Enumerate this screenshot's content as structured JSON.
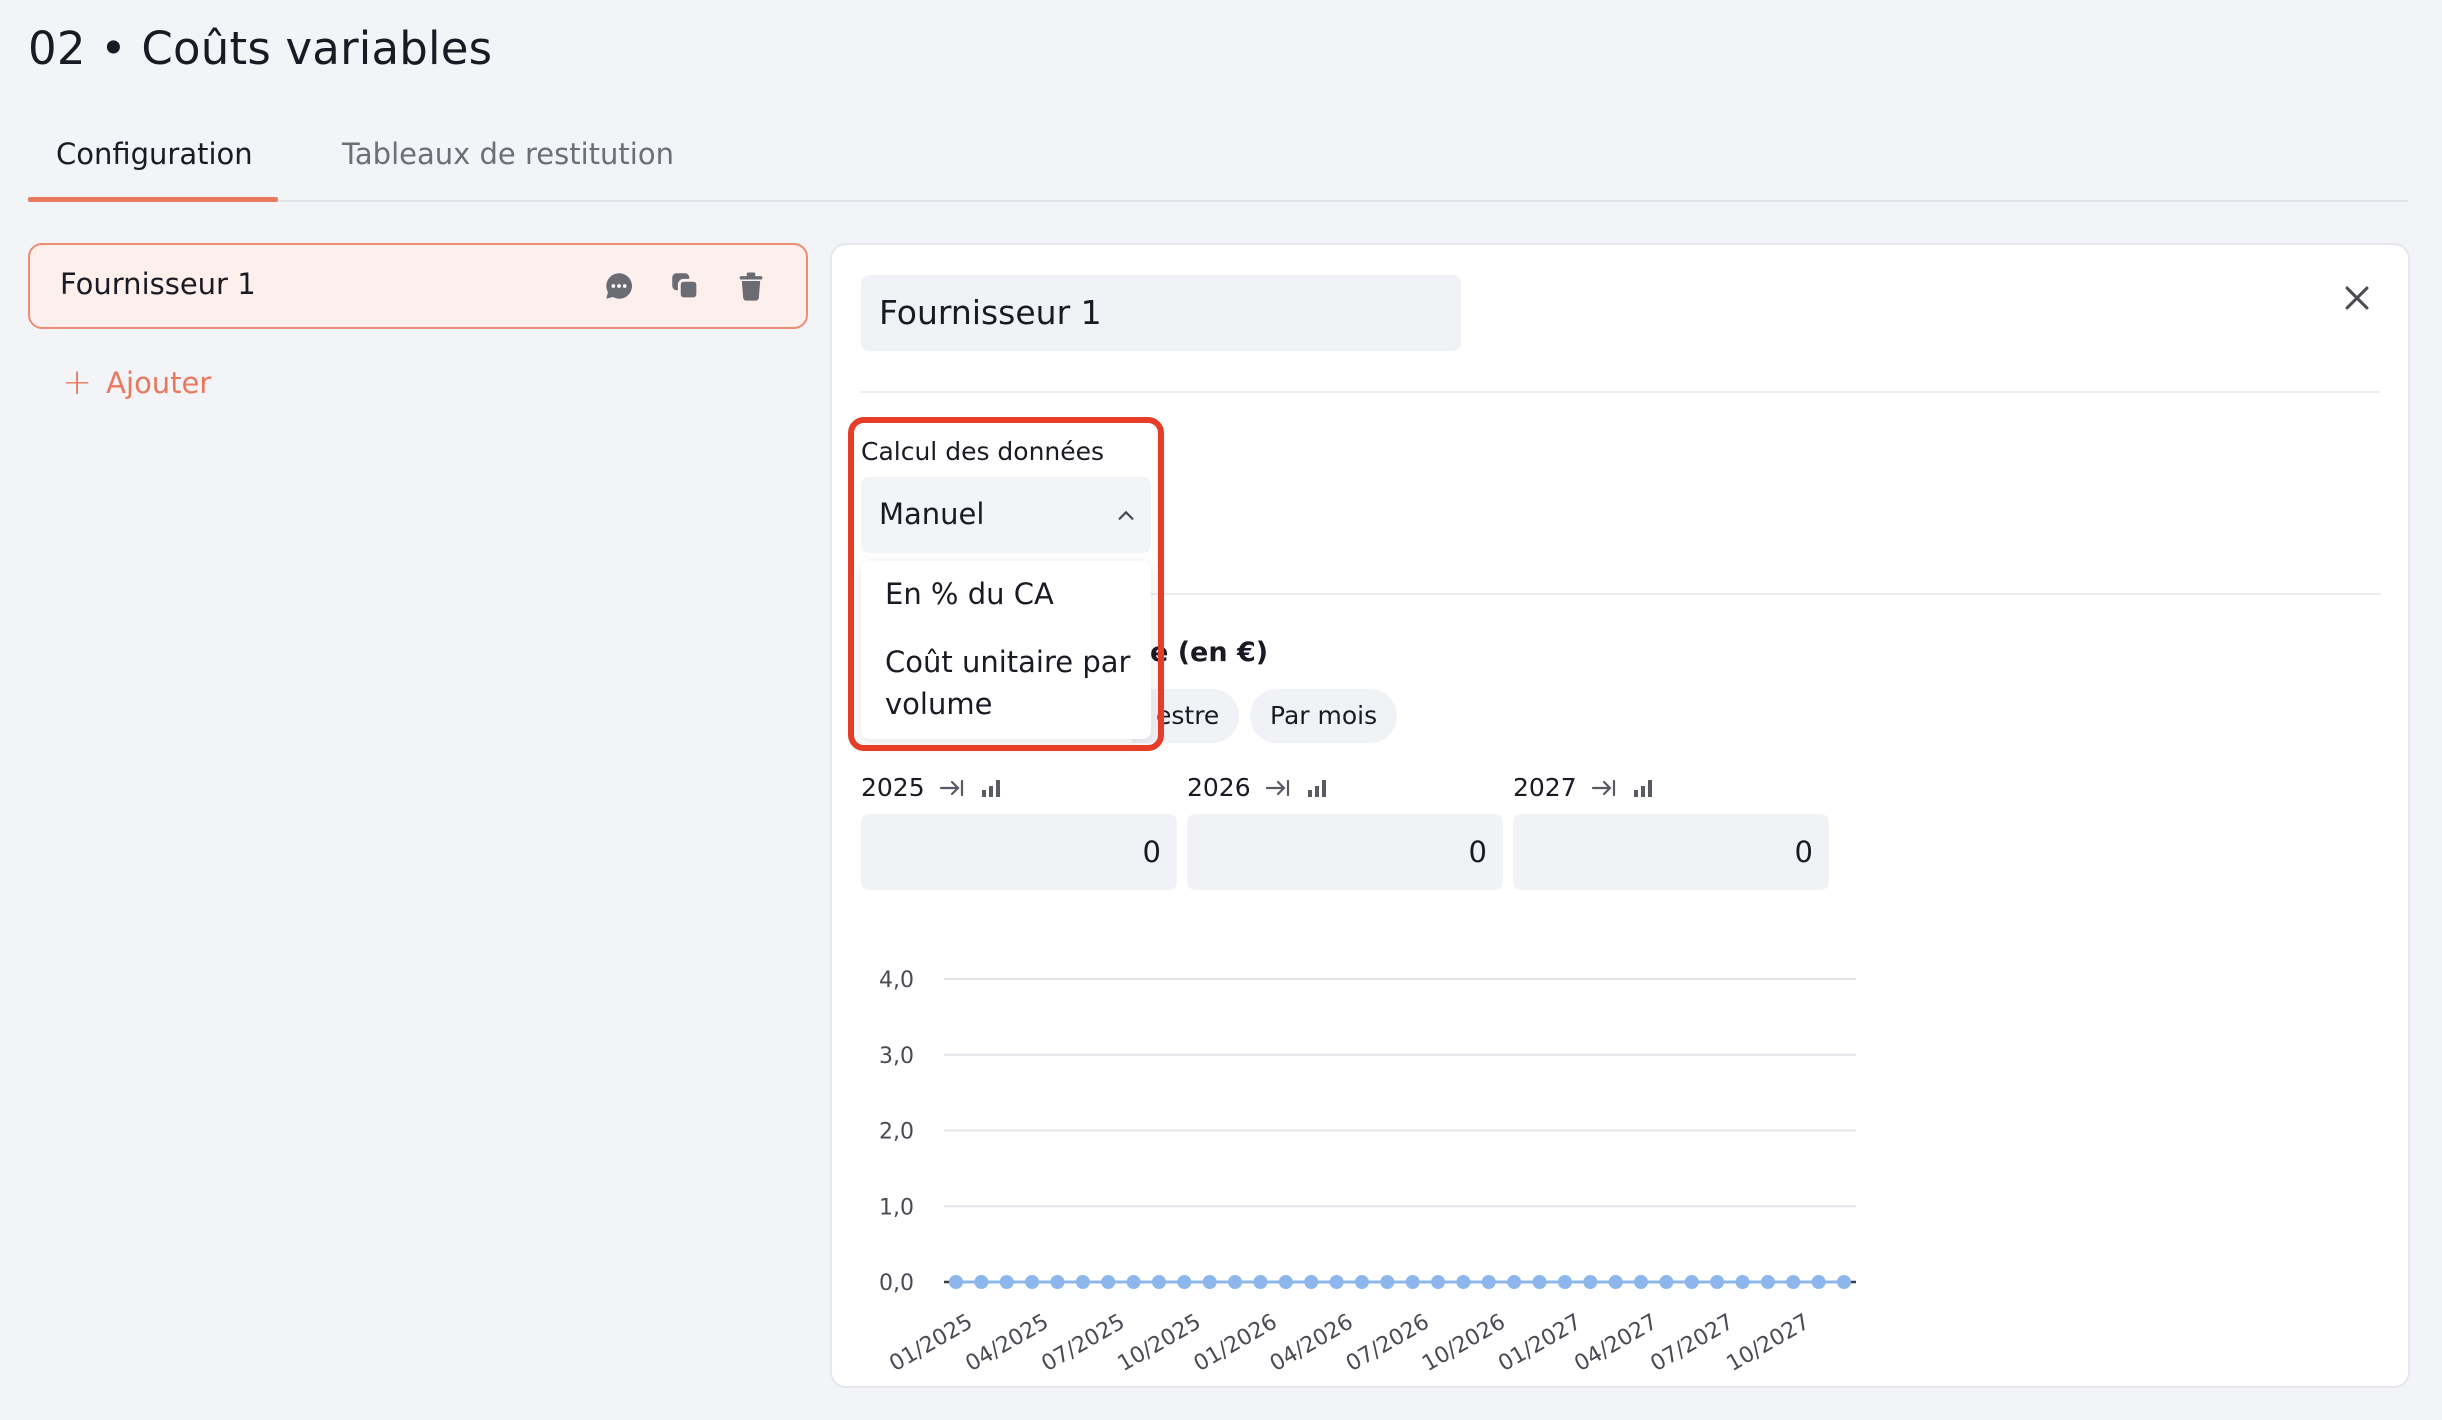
{
  "page": {
    "title": "02 • Coûts variables"
  },
  "tabs": [
    {
      "label": "Configuration",
      "active": true
    },
    {
      "label": "Tableaux de restitution",
      "active": false
    }
  ],
  "sidebar": {
    "items": [
      {
        "label": "Fournisseur 1",
        "icons": [
          "comment-icon",
          "duplicate-icon",
          "trash-icon"
        ]
      }
    ],
    "add_label": "Ajouter"
  },
  "panel": {
    "name_value": "Fournisseur 1",
    "calc": {
      "label": "Calcul des données",
      "selected": "Manuel",
      "options": [
        "En % du CA",
        "Coût unitaire par volume"
      ]
    },
    "section_title_fragment": "e (en €)",
    "period_chips": [
      "estre",
      "Par mois"
    ],
    "years": [
      {
        "label": "2025",
        "value": "0"
      },
      {
        "label": "2026",
        "value": "0"
      },
      {
        "label": "2027",
        "value": "0"
      }
    ]
  },
  "colors": {
    "accent": "#e8785e",
    "highlight": "#e53d28",
    "series": "#8db7ec"
  },
  "chart_data": {
    "type": "line",
    "ylim": [
      0,
      4
    ],
    "yticks": [
      "4,0",
      "3,0",
      "2,0",
      "1,0",
      "0,0"
    ],
    "xtick_labels": [
      "01/2025",
      "04/2025",
      "07/2025",
      "10/2025",
      "01/2026",
      "04/2026",
      "07/2026",
      "10/2026",
      "01/2027",
      "04/2027",
      "07/2027",
      "10/2027"
    ],
    "x": [
      "01/2025",
      "02/2025",
      "03/2025",
      "04/2025",
      "05/2025",
      "06/2025",
      "07/2025",
      "08/2025",
      "09/2025",
      "10/2025",
      "11/2025",
      "12/2025",
      "01/2026",
      "02/2026",
      "03/2026",
      "04/2026",
      "05/2026",
      "06/2026",
      "07/2026",
      "08/2026",
      "09/2026",
      "10/2026",
      "11/2026",
      "12/2026",
      "01/2027",
      "02/2027",
      "03/2027",
      "04/2027",
      "05/2027",
      "06/2027",
      "07/2027",
      "08/2027",
      "09/2027",
      "10/2027",
      "11/2027",
      "12/2027"
    ],
    "series": [
      {
        "values": [
          0,
          0,
          0,
          0,
          0,
          0,
          0,
          0,
          0,
          0,
          0,
          0,
          0,
          0,
          0,
          0,
          0,
          0,
          0,
          0,
          0,
          0,
          0,
          0,
          0,
          0,
          0,
          0,
          0,
          0,
          0,
          0,
          0,
          0,
          0,
          0
        ]
      }
    ],
    "grid": true
  }
}
